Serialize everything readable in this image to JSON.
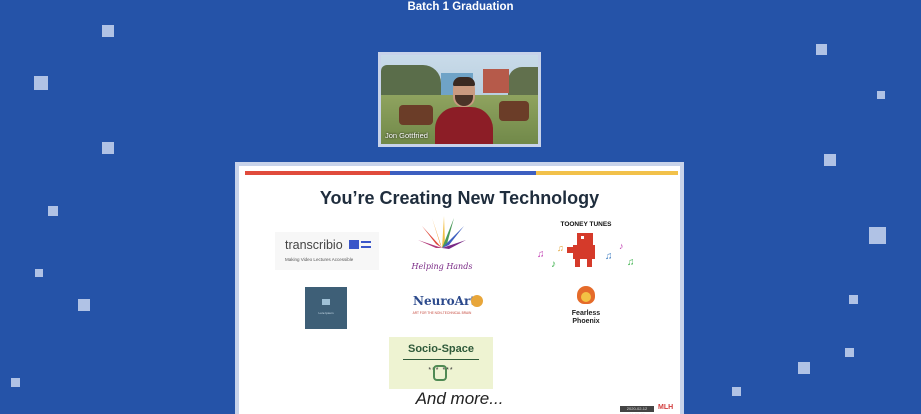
{
  "header": {
    "title": "Batch 1 Graduation"
  },
  "webcam": {
    "speaker_name": "Jon Gottfried"
  },
  "slide": {
    "title": "You’re Creating New Technology",
    "closing": "And more...",
    "stripe_colors": [
      "#e04b3c",
      "#3d5fc0",
      "#f2c14a"
    ],
    "logos": {
      "transcribio": {
        "name": "transcribio",
        "tagline": "Making Video Lectures Accessible"
      },
      "helping_hands": {
        "name": "Helping Hands"
      },
      "tooney_tunes": {
        "name": "TOONEY TUNES"
      },
      "square_logo": {
        "name": "Lore Ipsum"
      },
      "neuroart": {
        "name": "NeuroArt",
        "tagline": "ART FOR THE NON-TECHNICAL BRAIN"
      },
      "fearless_phoenix": {
        "name_line1": "Fearless",
        "name_line2": "Phoenix"
      },
      "socio_space": {
        "name": "Socio-Space",
        "stars": "*** ***"
      }
    },
    "watermark": {
      "timestamp": "2020-02-12 16:23:05",
      "brand": "MLH"
    }
  },
  "colors": {
    "background": "#2553a8",
    "slide_border": "#c8d3ea"
  }
}
